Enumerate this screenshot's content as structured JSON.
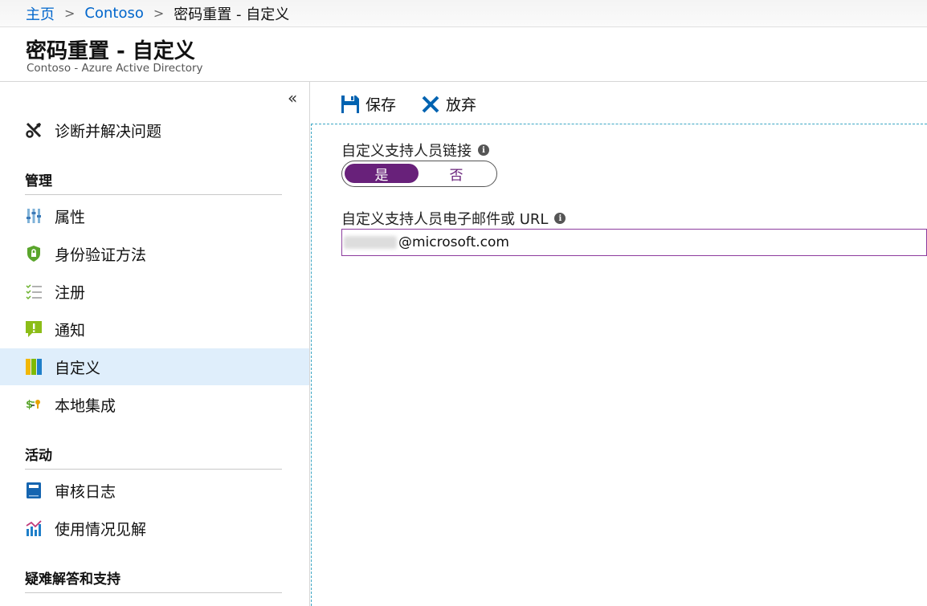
{
  "breadcrumb": {
    "items": [
      "主页",
      "Contoso",
      "密码重置 - 自定义"
    ],
    "separator": ">"
  },
  "header": {
    "title": "密码重置 - 自定义",
    "subtitle": "Contoso - Azure Active Directory"
  },
  "sidebar": {
    "collapse_glyph": "«",
    "top_item": {
      "label": "诊断并解决问题",
      "icon": "wrench-screwdriver-icon"
    },
    "sections": [
      {
        "heading": "管理",
        "items": [
          {
            "label": "属性",
            "icon": "properties-icon"
          },
          {
            "label": "身份验证方法",
            "icon": "shield-lock-icon"
          },
          {
            "label": "注册",
            "icon": "checklist-icon"
          },
          {
            "label": "通知",
            "icon": "notification-icon"
          },
          {
            "label": "自定义",
            "icon": "customization-icon",
            "active": true
          },
          {
            "label": "本地集成",
            "icon": "on-premises-integration-icon"
          }
        ]
      },
      {
        "heading": "活动",
        "items": [
          {
            "label": "审核日志",
            "icon": "audit-log-icon"
          },
          {
            "label": "使用情况见解",
            "icon": "usage-insights-icon"
          }
        ]
      },
      {
        "heading": "疑难解答和支持",
        "items": []
      }
    ]
  },
  "toolbar": {
    "save_label": "保存",
    "discard_label": "放弃"
  },
  "form": {
    "support_link_label": "自定义支持人员链接",
    "toggle_yes": "是",
    "toggle_no": "否",
    "toggle_selected": "是",
    "support_email_label": "自定义支持人员电子邮件或 URL",
    "support_email_value": "@microsoft.com"
  },
  "colors": {
    "accent_purple": "#68217a",
    "link_blue": "#0066cc",
    "active_nav_bg": "#dfeefb",
    "save_icon_blue": "#0063b1"
  }
}
